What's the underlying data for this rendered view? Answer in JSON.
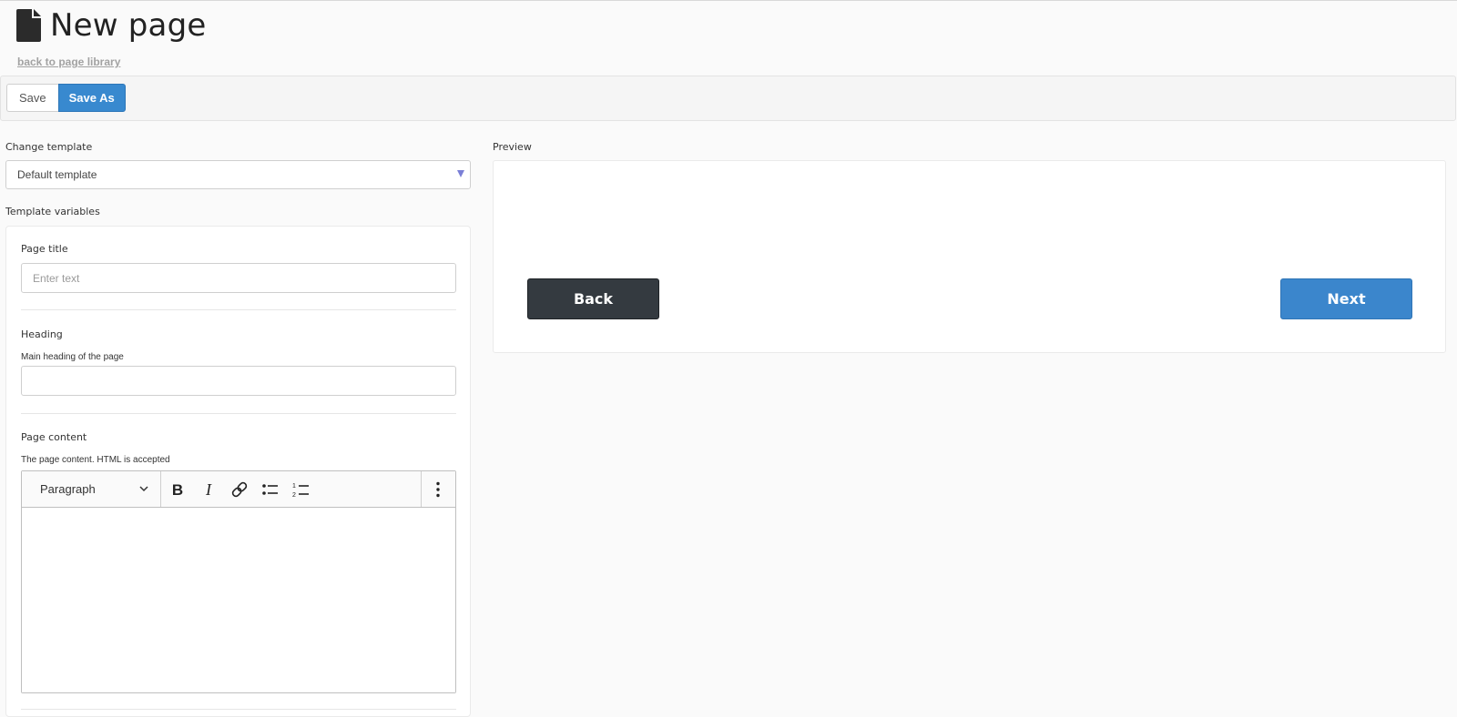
{
  "header": {
    "title": "New page",
    "icon": "document-icon",
    "back_link": "back to page library"
  },
  "toolbar": {
    "save_label": "Save",
    "save_as_label": "Save As"
  },
  "template": {
    "label": "Change template",
    "selected": "Default template"
  },
  "variables": {
    "label": "Template variables",
    "page_title": {
      "label": "Page title",
      "placeholder": "Enter text",
      "value": ""
    },
    "heading": {
      "label": "Heading",
      "help": "Main heading of the page",
      "value": ""
    },
    "page_content": {
      "label": "Page content",
      "help": "The page content. HTML is accepted",
      "editor": {
        "block_format": "Paragraph",
        "buttons": [
          "bold-icon",
          "italic-icon",
          "link-icon",
          "bulleted-list-icon",
          "numbered-list-icon",
          "more-options-icon"
        ]
      }
    }
  },
  "preview": {
    "label": "Preview",
    "back_label": "Back",
    "next_label": "Next"
  },
  "colors": {
    "primary": "#3889cf",
    "dark_button": "#343a40",
    "select_caret": "#7a7fd6"
  }
}
